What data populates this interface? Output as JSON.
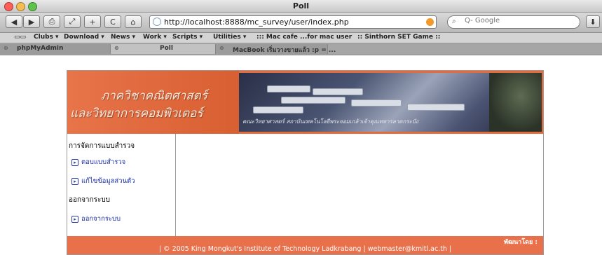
{
  "window": {
    "title": "Poll"
  },
  "toolbar": {
    "back": "◀",
    "forward": "▶",
    "print": "⎙",
    "resize": "⤢",
    "add": "+",
    "reload": "C",
    "home": "⌂",
    "url": "http://localhost:8888/mc_survey/user/index.php",
    "search_placeholder": "Q- Google",
    "downloads": "⬇"
  },
  "bookmarks": [
    {
      "label": "Clubs ▾"
    },
    {
      "label": "Download ▾"
    },
    {
      "label": "News ▾"
    },
    {
      "label": "Work ▾"
    },
    {
      "label": "Scripts ▾"
    },
    {
      "label": "Utilities ▾"
    },
    {
      "label": "::: Mac cafe ...for mac user"
    },
    {
      "label": ":: Sinthorn SET Game ::"
    }
  ],
  "tabs": [
    {
      "label": "phpMyAdmin"
    },
    {
      "label": "Poll"
    },
    {
      "label": "MacBook เริ่มวางขายแล้ว :p = ..."
    }
  ],
  "banner": {
    "line1": "ภาควิชาคณิตศาสตร์",
    "line2": "และวิทยาการคอมพิวเตอร์",
    "sub": "คณะวิทยาศาสตร์ สถาบันเทคโนโลยีพระจอมเกล้าเจ้าคุณทหารลาดกระบัง"
  },
  "sidebar": {
    "section1": "การจัดการแบบสำรวจ",
    "link1": "ตอบแบบสำรวจ",
    "link2": "แก้ไขข้อมูลส่วนตัว",
    "section2": "ออกจากระบบ",
    "link3": "ออกจากระบบ"
  },
  "footer": {
    "developed_by": "พัฒนาโดย :",
    "copyright": "| © 2005 King Mongkut's Institute of Technology Ladkrabang | webmaster@kmitl.ac.th |"
  }
}
